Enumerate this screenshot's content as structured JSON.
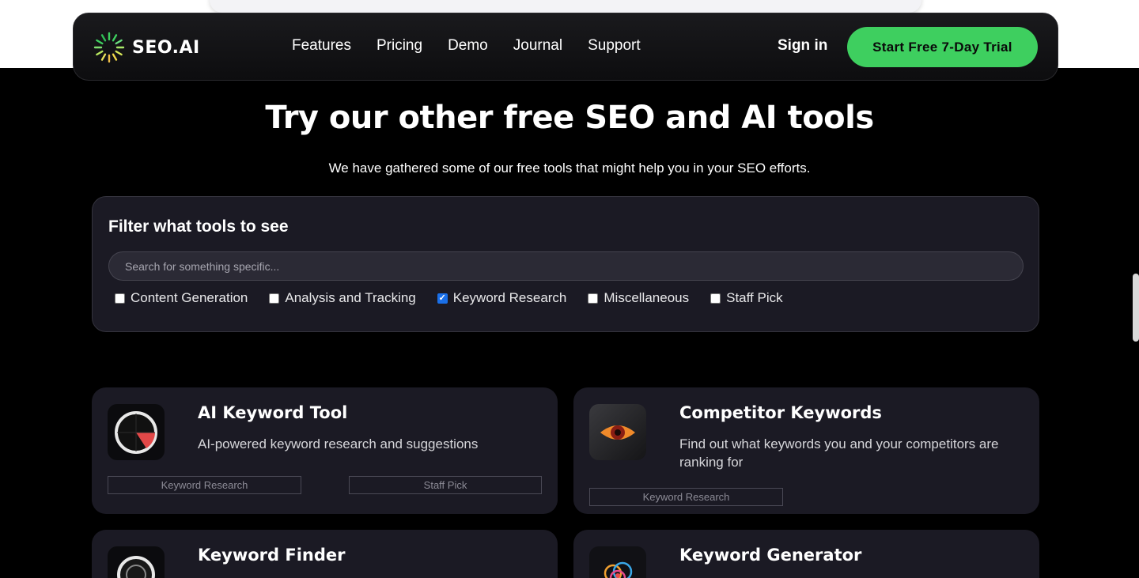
{
  "brand": {
    "logo_text": "SEO.AI",
    "accent": "#3ecf5f"
  },
  "nav": {
    "links": [
      "Features",
      "Pricing",
      "Demo",
      "Journal",
      "Support"
    ],
    "signin": "Sign in",
    "cta": "Start Free 7-Day Trial"
  },
  "hero": {
    "title": "Try our other free SEO and AI tools",
    "subtitle": "We have gathered some of our free tools that might help you in your SEO efforts."
  },
  "filter": {
    "title": "Filter what tools to see",
    "search_placeholder": "Search for something specific...",
    "options": [
      {
        "label": "Content Generation",
        "checked": false
      },
      {
        "label": "Analysis and Tracking",
        "checked": false
      },
      {
        "label": "Keyword Research",
        "checked": true
      },
      {
        "label": "Miscellaneous",
        "checked": false
      },
      {
        "label": "Staff Pick",
        "checked": false
      }
    ]
  },
  "tools": [
    {
      "title": "AI Keyword Tool",
      "description": "AI-powered keyword research and suggestions",
      "tags": [
        "Keyword Research",
        "Staff Pick"
      ],
      "icon": "target-icon"
    },
    {
      "title": "Competitor Keywords",
      "description": "Find out what keywords you and your competitors are ranking for",
      "tags": [
        "Keyword Research"
      ],
      "icon": "eye-icon"
    },
    {
      "title": "Keyword Finder",
      "description": "",
      "tags": [],
      "icon": "lens-icon"
    },
    {
      "title": "Keyword Generator",
      "description": "",
      "tags": [],
      "icon": "cloud-icon"
    }
  ]
}
